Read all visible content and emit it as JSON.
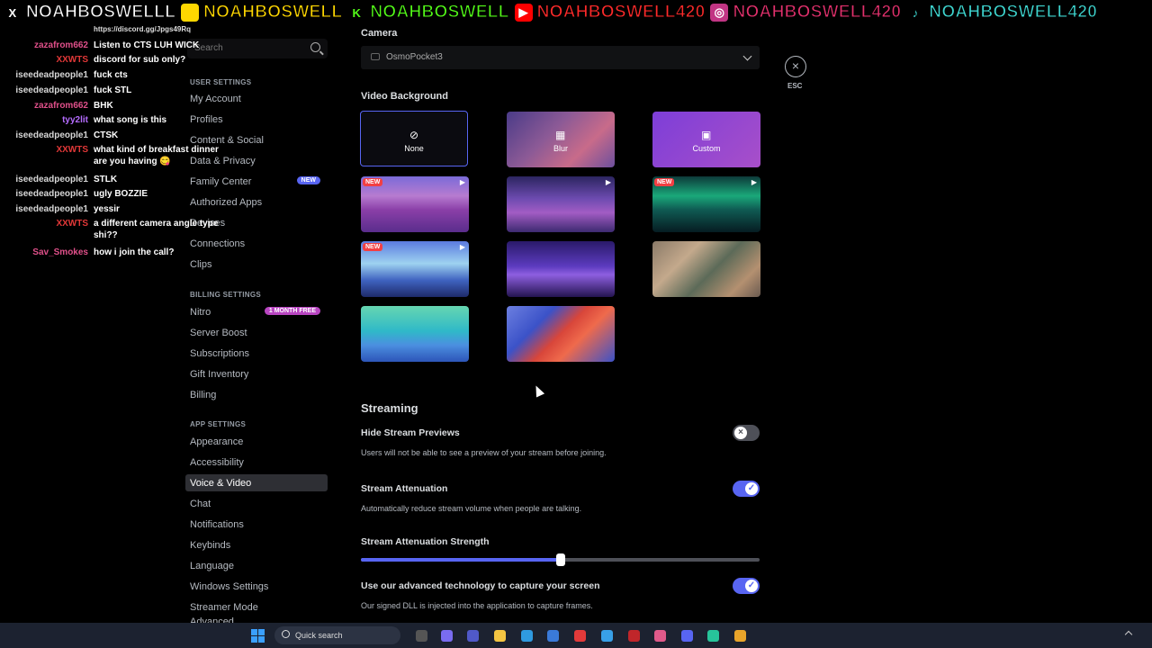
{
  "banner": [
    {
      "icon": "x-icon",
      "glyph": "X",
      "text": "NOAHBOSWELLL",
      "color": "#ffffff",
      "iconbg": "#000000"
    },
    {
      "icon": "kick-icon",
      "glyph": "",
      "text": "NOAHBOSWELL",
      "color": "#ffd700",
      "iconbg": "#ffd700"
    },
    {
      "icon": "kick-k-icon",
      "glyph": "K",
      "text": "NOAHBOSWELL",
      "color": "#53fc18",
      "iconbg": "#000000"
    },
    {
      "icon": "youtube-icon",
      "glyph": "▶",
      "text": "NOAHBOSWELL420",
      "color": "#ff2a2a",
      "iconbg": "#ff0000"
    },
    {
      "icon": "instagram-icon",
      "glyph": "◎",
      "text": "NOAHBOSWELL420",
      "color": "#e1306c",
      "iconbg": "#c13584"
    },
    {
      "icon": "tiktok-icon",
      "glyph": "♪",
      "text": "NOAHBOSWELL420",
      "color": "#3ed6d0",
      "iconbg": "#000000"
    }
  ],
  "chat": [
    {
      "user": "",
      "msg": "https://discord.gg/Jpgs49Rq",
      "color": "#ffffff"
    },
    {
      "user": "zazafrom662",
      "msg": "Listen to CTS LUH WICK",
      "color": "#e0508a"
    },
    {
      "user": "XXWTS",
      "msg": "discord for sub only?",
      "color": "#e23838"
    },
    {
      "user": "iseedeadpeople1",
      "msg": "fuck cts",
      "color": "#d7d7d7"
    },
    {
      "user": "iseedeadpeople1",
      "msg": "fuck STL",
      "color": "#d7d7d7"
    },
    {
      "user": "zazafrom662",
      "msg": "BHK",
      "color": "#e0508a"
    },
    {
      "user": "tyy2lit",
      "msg": "what song is this",
      "color": "#b56cff"
    },
    {
      "user": "iseedeadpeople1",
      "msg": "CTSK",
      "color": "#d7d7d7"
    },
    {
      "user": "XXWTS",
      "msg": "what kind of breakfast dinner",
      "color": "#e23838"
    },
    {
      "user": "",
      "msg": "are you having 😋",
      "color": "#ffffff"
    },
    {
      "user": "iseedeadpeople1",
      "msg": "STLK",
      "color": "#d7d7d7"
    },
    {
      "user": "iseedeadpeople1",
      "msg": "ugly BOZZIE",
      "color": "#d7d7d7"
    },
    {
      "user": "iseedeadpeople1",
      "msg": "yessir",
      "color": "#d7d7d7"
    },
    {
      "user": "XXWTS",
      "msg": "a different camera angle type",
      "color": "#e23838"
    },
    {
      "user": "",
      "msg": "shi??",
      "color": "#ffffff"
    },
    {
      "user": "Sav_Smokes",
      "msg": "how i join the call?",
      "color": "#e0508a"
    }
  ],
  "search": {
    "placeholder": "Search"
  },
  "sidebar": {
    "user_settings": "USER SETTINGS",
    "user_items": [
      "My Account",
      "Profiles",
      "Content & Social",
      "Data & Privacy",
      "Family Center",
      "Authorized Apps",
      "Devices",
      "Connections",
      "Clips"
    ],
    "family_badge": "NEW",
    "billing_settings": "BILLING SETTINGS",
    "billing_items": [
      "Nitro",
      "Server Boost",
      "Subscriptions",
      "Gift Inventory",
      "Billing"
    ],
    "nitro_badge": "1 MONTH FREE",
    "app_settings": "APP SETTINGS",
    "app_items": [
      "Appearance",
      "Accessibility",
      "Voice & Video",
      "Chat",
      "Notifications",
      "Keybinds",
      "Language",
      "Windows Settings",
      "Streamer Mode",
      "Advanced"
    ],
    "active": "Voice & Video"
  },
  "camera": {
    "label": "Camera",
    "value": "OsmoPocket3"
  },
  "esc": {
    "label": "ESC"
  },
  "video_background": {
    "label": "Video Background",
    "options": [
      {
        "name": "None",
        "glyph": "⊘",
        "selected": true
      },
      {
        "name": "Blur",
        "glyph": "▦"
      },
      {
        "name": "Custom",
        "glyph": "▣"
      }
    ],
    "new_tag": "NEW"
  },
  "streaming": {
    "title": "Streaming",
    "hide_previews": {
      "label": "Hide Stream Previews",
      "desc": "Users will not be able to see a preview of your stream before joining.",
      "enabled": false
    },
    "attenuation": {
      "label": "Stream Attenuation",
      "desc": "Automatically reduce stream volume when people are talking.",
      "enabled": true
    },
    "attenuation_strength": {
      "label": "Stream Attenuation Strength",
      "value": 0.5
    },
    "capture": {
      "label": "Use our advanced technology to capture your screen",
      "desc": "Our signed DLL is injected into the application to capture frames.",
      "enabled": true
    }
  },
  "taskbar": {
    "search": "Quick search"
  },
  "colors": {
    "accent": "#5865f2",
    "danger": "#f23f43",
    "nitro": "#b845c1"
  }
}
